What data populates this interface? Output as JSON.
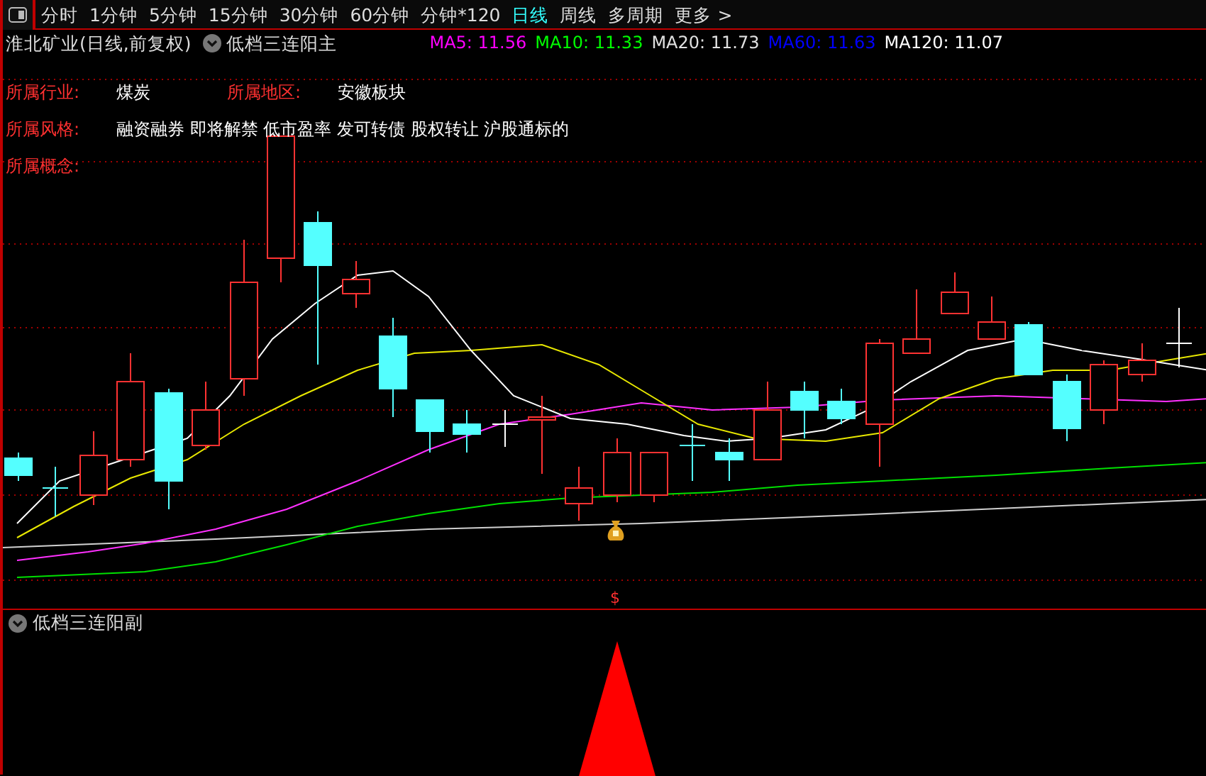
{
  "toolbar": {
    "tabs": [
      {
        "label": "分时",
        "selected": false
      },
      {
        "label": "1分钟",
        "selected": false
      },
      {
        "label": "5分钟",
        "selected": false
      },
      {
        "label": "15分钟",
        "selected": false
      },
      {
        "label": "30分钟",
        "selected": false
      },
      {
        "label": "60分钟",
        "selected": false
      },
      {
        "label": "分钟*120",
        "selected": false
      },
      {
        "label": "日线",
        "selected": true
      },
      {
        "label": "周线",
        "selected": false
      },
      {
        "label": "多周期",
        "selected": false
      }
    ],
    "more": {
      "label": "更多",
      "arrow": ">"
    }
  },
  "main_pane": {
    "stock_title": "淮北矿业(日线,前复权)",
    "indicator": "低档三连阳主",
    "moving_averages": [
      {
        "label": "MA5: 11.56",
        "color": "#ff00ff"
      },
      {
        "label": "MA10: 11.33",
        "color": "#00ff00"
      },
      {
        "label": "MA20: 11.73",
        "color": "#e0e0e0"
      },
      {
        "label": "MA60: 11.63",
        "color": "#0000ff"
      },
      {
        "label": "MA120: 11.07",
        "color": "#ffffff"
      }
    ],
    "info_lines": [
      [
        {
          "label": "所属行业:",
          "value": "煤炭"
        },
        {
          "label": "所属地区:",
          "value": "安徽板块"
        }
      ],
      [
        {
          "label": "所属风格:",
          "value": "融资融券 即将解禁 低市盈率 发可转债 股权转让 沪股通标的"
        }
      ],
      [
        {
          "label": "所属概念:"
        }
      ]
    ],
    "signal_mark": "$"
  },
  "sub_pane": {
    "indicator": "低档三连阳副"
  }
}
